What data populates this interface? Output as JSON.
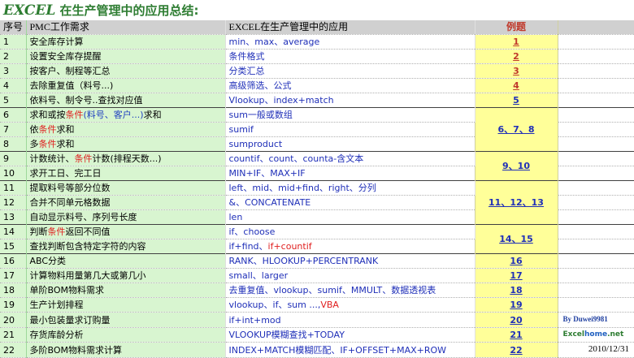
{
  "title": {
    "en": "EXCEL",
    "cn": " 在生产管理中的应用总结:"
  },
  "headers": {
    "idx": "序号",
    "need": "PMC工作需求",
    "app": "EXCEL在生产管理中的应用",
    "ex": "例题"
  },
  "rows": [
    {
      "idx": "1",
      "need": [
        {
          "t": "安全库存计算"
        }
      ],
      "app": [
        {
          "t": "min、max、average"
        }
      ]
    },
    {
      "idx": "2",
      "need": [
        {
          "t": "设置安全库存提醒"
        }
      ],
      "app": [
        {
          "t": "条件格式"
        }
      ]
    },
    {
      "idx": "3",
      "need": [
        {
          "t": "按客户、制程等汇总"
        }
      ],
      "app": [
        {
          "t": "分类汇总"
        }
      ]
    },
    {
      "idx": "4",
      "need": [
        {
          "t": "去除重复值（料号...)"
        }
      ],
      "app": [
        {
          "t": "高级筛选、公式"
        }
      ]
    },
    {
      "idx": "5",
      "need": [
        {
          "t": "依料号、制令号..查找对应值"
        }
      ],
      "app": [
        {
          "t": "Vlookup、index+match"
        }
      ]
    },
    {
      "idx": "6",
      "need": [
        {
          "t": "求和或按"
        },
        {
          "t": "条件",
          "c": "red"
        },
        {
          "t": "(料号、客户...)",
          "c": "blue"
        },
        {
          "t": "求和"
        }
      ],
      "app": [
        {
          "t": "sum一般或数组"
        }
      ]
    },
    {
      "idx": "7",
      "need": [
        {
          "t": "依"
        },
        {
          "t": "条件",
          "c": "red"
        },
        {
          "t": "求和"
        }
      ],
      "app": [
        {
          "t": "sumif"
        }
      ]
    },
    {
      "idx": "8",
      "need": [
        {
          "t": "多"
        },
        {
          "t": "条件",
          "c": "red"
        },
        {
          "t": "求和"
        }
      ],
      "app": [
        {
          "t": "sumproduct"
        }
      ]
    },
    {
      "idx": "9",
      "need": [
        {
          "t": "计数统计、"
        },
        {
          "t": "条件",
          "c": "red"
        },
        {
          "t": "计数(排程天数...)"
        }
      ],
      "app": [
        {
          "t": "countif、count、counta-含文本"
        }
      ]
    },
    {
      "idx": "10",
      "need": [
        {
          "t": "求开工日、完工日"
        }
      ],
      "app": [
        {
          "t": "MIN+IF、MAX+IF"
        }
      ]
    },
    {
      "idx": "11",
      "need": [
        {
          "t": "提取料号等部分位数"
        }
      ],
      "app": [
        {
          "t": "left、mid、mid+find、right、分列"
        }
      ]
    },
    {
      "idx": "12",
      "need": [
        {
          "t": "合并不同单元格数据"
        }
      ],
      "app": [
        {
          "t": "&、CONCATENATE"
        }
      ]
    },
    {
      "idx": "13",
      "need": [
        {
          "t": "自动显示料号、序列号长度"
        }
      ],
      "app": [
        {
          "t": "len"
        }
      ]
    },
    {
      "idx": "14",
      "need": [
        {
          "t": "判断"
        },
        {
          "t": "条件",
          "c": "red"
        },
        {
          "t": "返回不同值"
        }
      ],
      "app": [
        {
          "t": "if、choose"
        }
      ]
    },
    {
      "idx": "15",
      "need": [
        {
          "t": "查找判断包含特定字符的内容"
        }
      ],
      "app": [
        {
          "t": "if+find、"
        },
        {
          "t": "if+countif",
          "c": "red"
        }
      ]
    },
    {
      "idx": "16",
      "need": [
        {
          "t": "ABC分类"
        }
      ],
      "app": [
        {
          "t": "RANK、HLOOKUP+PERCENTRANK"
        }
      ]
    },
    {
      "idx": "17",
      "need": [
        {
          "t": "计算物料用量第几大或第几小"
        }
      ],
      "app": [
        {
          "t": "small、larger"
        }
      ]
    },
    {
      "idx": "18",
      "need": [
        {
          "t": "单阶BOM物料需求"
        }
      ],
      "app": [
        {
          "t": "去重复值、vlookup、sumif、MMULT、数据透视表"
        }
      ]
    },
    {
      "idx": "19",
      "need": [
        {
          "t": "生产计划排程"
        }
      ],
      "app": [
        {
          "t": "vlookup、if、sum ...,"
        },
        {
          "t": "VBA",
          "c": "red"
        }
      ]
    },
    {
      "idx": "20",
      "need": [
        {
          "t": "最小包装量求订购量"
        }
      ],
      "app": [
        {
          "t": "if+int+mod"
        }
      ]
    },
    {
      "idx": "21",
      "need": [
        {
          "t": "存货库龄分析"
        }
      ],
      "app": [
        {
          "t": "VLOOKUP模糊查找+TODAY"
        }
      ]
    },
    {
      "idx": "22",
      "need": [
        {
          "t": "多阶BOM物料需求计算"
        }
      ],
      "app": [
        {
          "t": "INDEX+MATCH模糊匹配、IF+OFFSET+MAX+ROW"
        }
      ]
    }
  ],
  "examples": {
    "e1": "1",
    "e2": "2",
    "e3": "3",
    "e4": "4",
    "e5": "5",
    "e6": "6、7、8",
    "e9": "9、10",
    "e11": "11、12、13",
    "e14": "14、15",
    "e16": "16",
    "e17": "17",
    "e18": "18",
    "e19": "19",
    "e20": "20",
    "e21": "21",
    "e22": "22"
  },
  "side": {
    "by": "By Duwei9981",
    "site_a": "Excel",
    "site_b": "home",
    "site_c": ".net",
    "date": "2010/12/31"
  },
  "colors": {
    "green_fill": "#d8f5d0",
    "yellow_fill": "#ffff99",
    "header_fill": "#d0d0d0",
    "link_blue": "#1f2fb8",
    "red": "#e02020",
    "title_green": "#2e7d32"
  }
}
